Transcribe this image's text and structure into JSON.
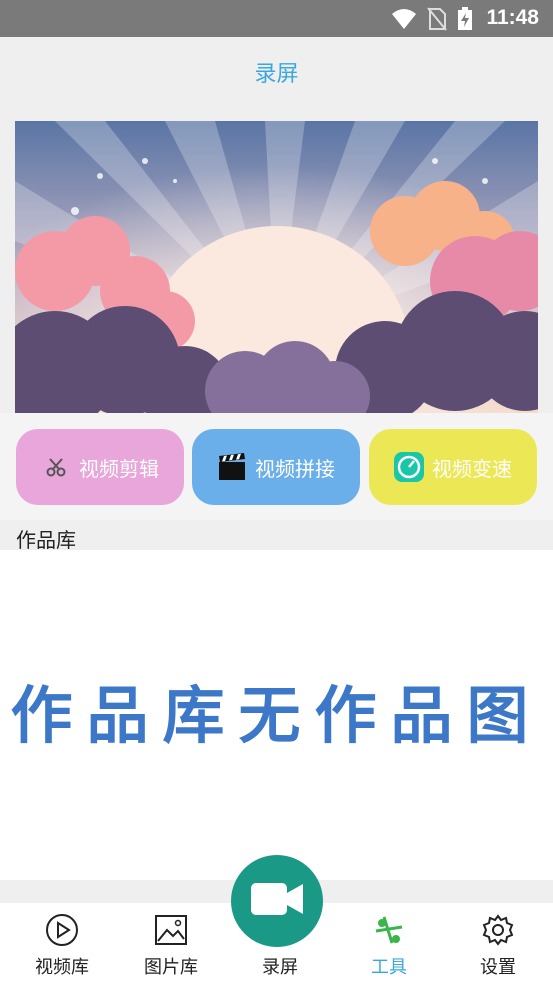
{
  "status": {
    "time": "11:48"
  },
  "header": {
    "title": "录屏"
  },
  "tools": [
    {
      "label": "视频剪辑",
      "icon": "scissors-icon",
      "color": "#e8a6da"
    },
    {
      "label": "视频拼接",
      "icon": "clapperboard-icon",
      "color": "#6aaeea"
    },
    {
      "label": "视频变速",
      "icon": "speedometer-icon",
      "color": "#ece754"
    }
  ],
  "works": {
    "label": "作品库",
    "empty_text": "作品库无作品图"
  },
  "tabs": [
    {
      "label": "视频库",
      "icon": "play-circle-icon"
    },
    {
      "label": "图片库",
      "icon": "image-icon"
    },
    {
      "label": "录屏",
      "icon": "video-camera-icon"
    },
    {
      "label": "工具",
      "icon": "tools-scissors-icon",
      "active": true
    },
    {
      "label": "设置",
      "icon": "gear-icon"
    }
  ],
  "colors": {
    "accent": "#3aa8e0",
    "fab": "#1a9a86",
    "empty_text": "#3d78c8"
  }
}
